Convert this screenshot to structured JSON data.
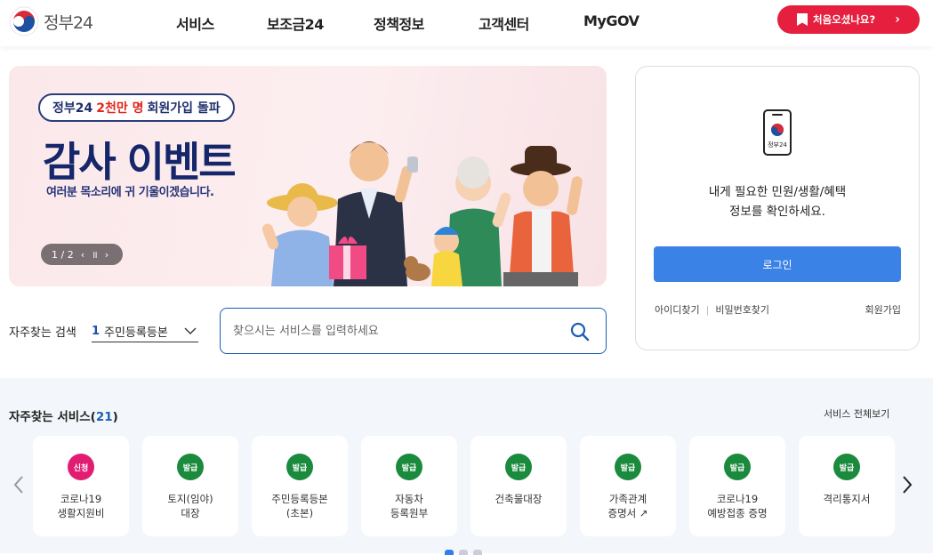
{
  "header": {
    "logo_text": "정부24",
    "nav": [
      "서비스",
      "보조금24",
      "정책정보",
      "고객센터",
      "MyGOV"
    ],
    "first_visit_button": "처음오셨나요?"
  },
  "banner": {
    "pill_prefix": "정부24",
    "pill_highlight": "2천만 명",
    "pill_suffix": "회원가입 돌파",
    "title": "감사 이벤트",
    "subtitle": "여러분 목소리에 귀 기울이겠습니다.",
    "pager": "1 / 2"
  },
  "quick": {
    "label": "자주찾는 검색",
    "selected_num": "1",
    "selected_value": "주민등록등본"
  },
  "search": {
    "placeholder": "찾으시는 서비스를 입력하세요"
  },
  "login": {
    "phone_label": "정부24",
    "message_line1": "내게 필요한 민원/생활/혜택",
    "message_line2": "정보를 확인하세요.",
    "button": "로그인",
    "find_id": "아이디찾기",
    "find_pw": "비밀번호찾기",
    "join": "회원가입"
  },
  "services": {
    "title": "자주찾는 서비스",
    "count": "21",
    "view_all": "서비스 전체보기",
    "items": [
      {
        "badge": "신청",
        "color": "pink",
        "line1": "코로나19",
        "line2": "생활지원비"
      },
      {
        "badge": "발급",
        "color": "green",
        "line1": "토지(임야)",
        "line2": "대장"
      },
      {
        "badge": "발급",
        "color": "green",
        "line1": "주민등록등본",
        "line2": "(초본)"
      },
      {
        "badge": "발급",
        "color": "green",
        "line1": "자동차",
        "line2": "등록원부"
      },
      {
        "badge": "발급",
        "color": "green",
        "line1": "건축물대장",
        "line2": ""
      },
      {
        "badge": "발급",
        "color": "green",
        "line1": "가족관계",
        "line2": "증명서 ↗"
      },
      {
        "badge": "발급",
        "color": "green",
        "line1": "코로나19",
        "line2": "예방접종 증명"
      },
      {
        "badge": "발급",
        "color": "green",
        "line1": "격리통지서",
        "line2": ""
      }
    ]
  },
  "colors": {
    "accent_red": "#e51f3d",
    "login_blue": "#3b82e6",
    "navy": "#16266b",
    "badge_green": "#1a8a3c",
    "badge_pink": "#e11d72"
  }
}
